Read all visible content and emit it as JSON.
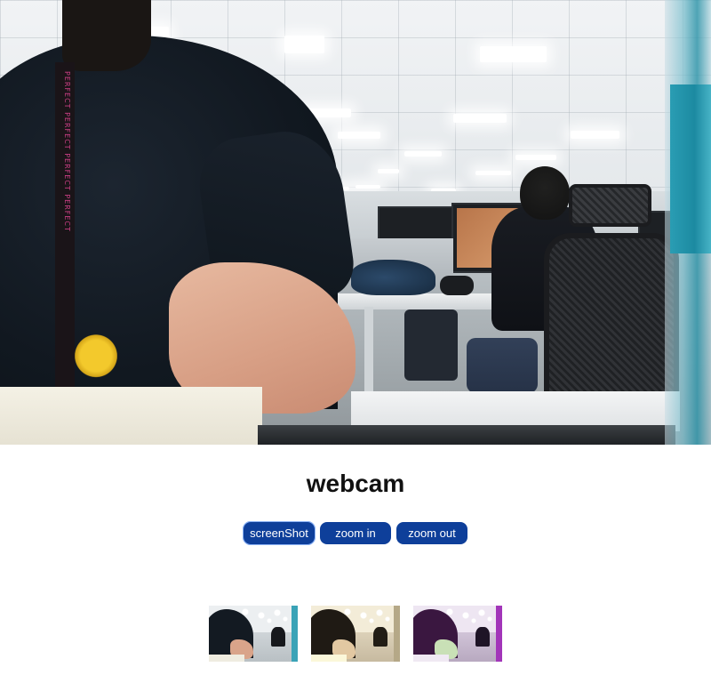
{
  "page": {
    "title": "webcam"
  },
  "buttons": {
    "screenshot_label": "screenShot",
    "zoom_in_label": "zoom in",
    "zoom_out_label": "zoom out"
  },
  "feed": {
    "lanyard_text": "PERFECT PERFECT PERFECT PERFECT"
  },
  "thumbnails": [
    {
      "filter": "normal"
    },
    {
      "filter": "sepia"
    },
    {
      "filter": "purple"
    }
  ],
  "colors": {
    "button_bg": "#0e3f9a",
    "button_text": "#ffffff",
    "title_text": "#111111"
  }
}
